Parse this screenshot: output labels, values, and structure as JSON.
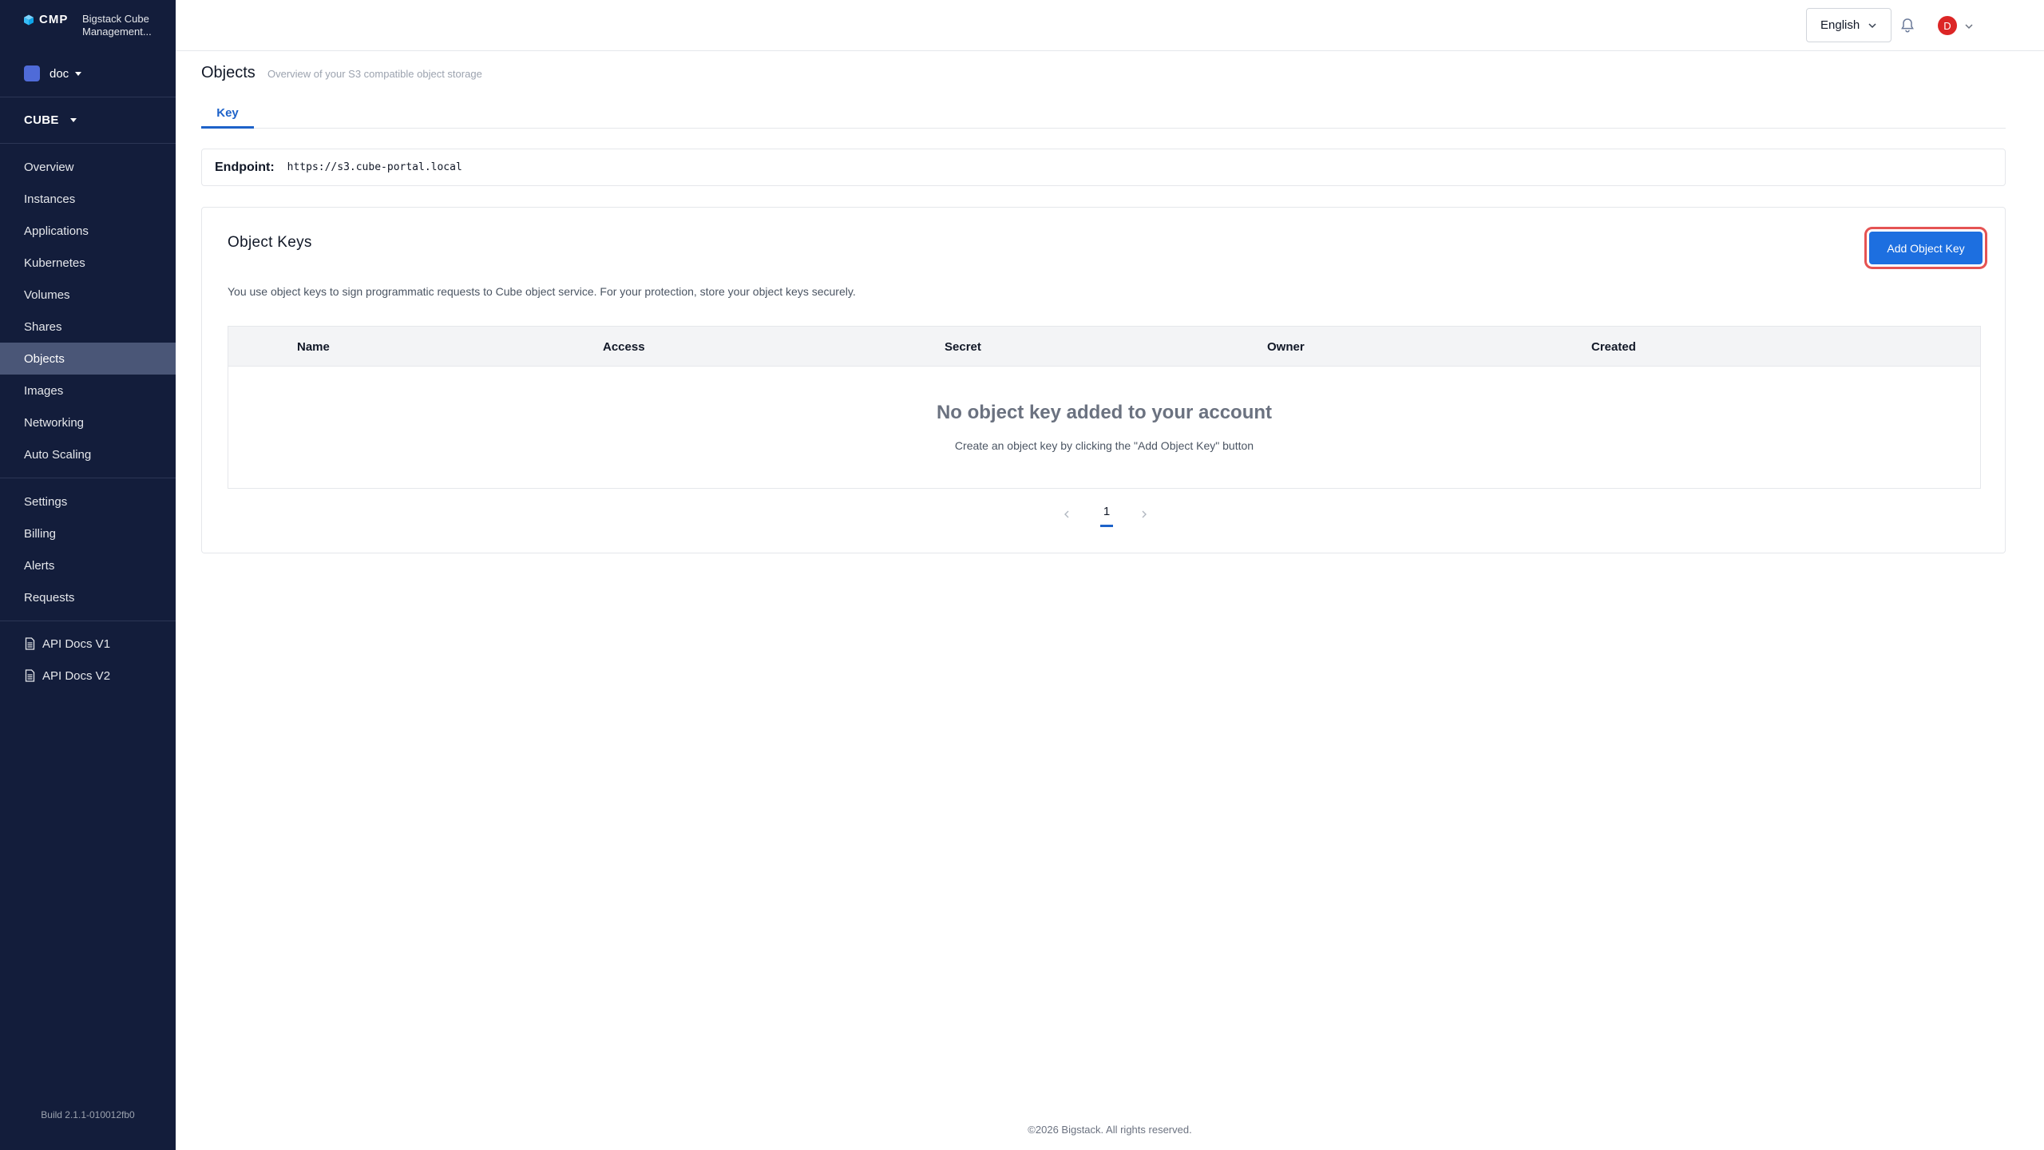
{
  "brand": {
    "short": "CMP",
    "name": "Bigstack Cube Management..."
  },
  "project": {
    "label": "doc"
  },
  "region": {
    "label": "CUBE"
  },
  "sidebar": {
    "items": [
      {
        "label": "Overview"
      },
      {
        "label": "Instances"
      },
      {
        "label": "Applications"
      },
      {
        "label": "Kubernetes"
      },
      {
        "label": "Volumes"
      },
      {
        "label": "Shares"
      },
      {
        "label": "Objects"
      },
      {
        "label": "Images"
      },
      {
        "label": "Networking"
      },
      {
        "label": "Auto Scaling"
      }
    ],
    "settings_items": [
      {
        "label": "Settings"
      },
      {
        "label": "Billing"
      },
      {
        "label": "Alerts"
      },
      {
        "label": "Requests"
      }
    ],
    "docs": [
      {
        "label": "API Docs V1"
      },
      {
        "label": "API Docs V2"
      }
    ],
    "build": "Build 2.1.1-010012fb0",
    "active": "Objects"
  },
  "topbar": {
    "language": "English",
    "avatar_initial": "D"
  },
  "page": {
    "title": "Objects",
    "subtitle": "Overview of your S3 compatible object storage",
    "tabs": [
      {
        "label": "Key",
        "active": true
      }
    ]
  },
  "endpoint": {
    "label": "Endpoint:",
    "value": "https://s3.cube-portal.local"
  },
  "keys_card": {
    "title": "Object Keys",
    "add_button": "Add Object Key",
    "description": "You use object keys to sign programmatic requests to Cube object service. For your protection, store your object keys securely.",
    "columns": [
      "Name",
      "Access",
      "Secret",
      "Owner",
      "Created"
    ],
    "empty_title": "No object key added to your account",
    "empty_subtitle": "Create an object key by clicking the \"Add Object Key\" button",
    "pagination": {
      "current_page": "1"
    }
  },
  "footer": {
    "text": "©2026 Bigstack. All rights reserved."
  },
  "colors": {
    "sidebar_bg": "#131d3b",
    "sidebar_active": "#4a5677",
    "primary": "#1d6fe0",
    "accent_blue": "#1d62c9",
    "avatar": "#dc2626",
    "highlight_ring": "#e55353"
  },
  "icons": {
    "brand": "cube-icon",
    "bell": "bell-icon",
    "doc": "document-icon",
    "chevron": "chevron-down-icon"
  }
}
